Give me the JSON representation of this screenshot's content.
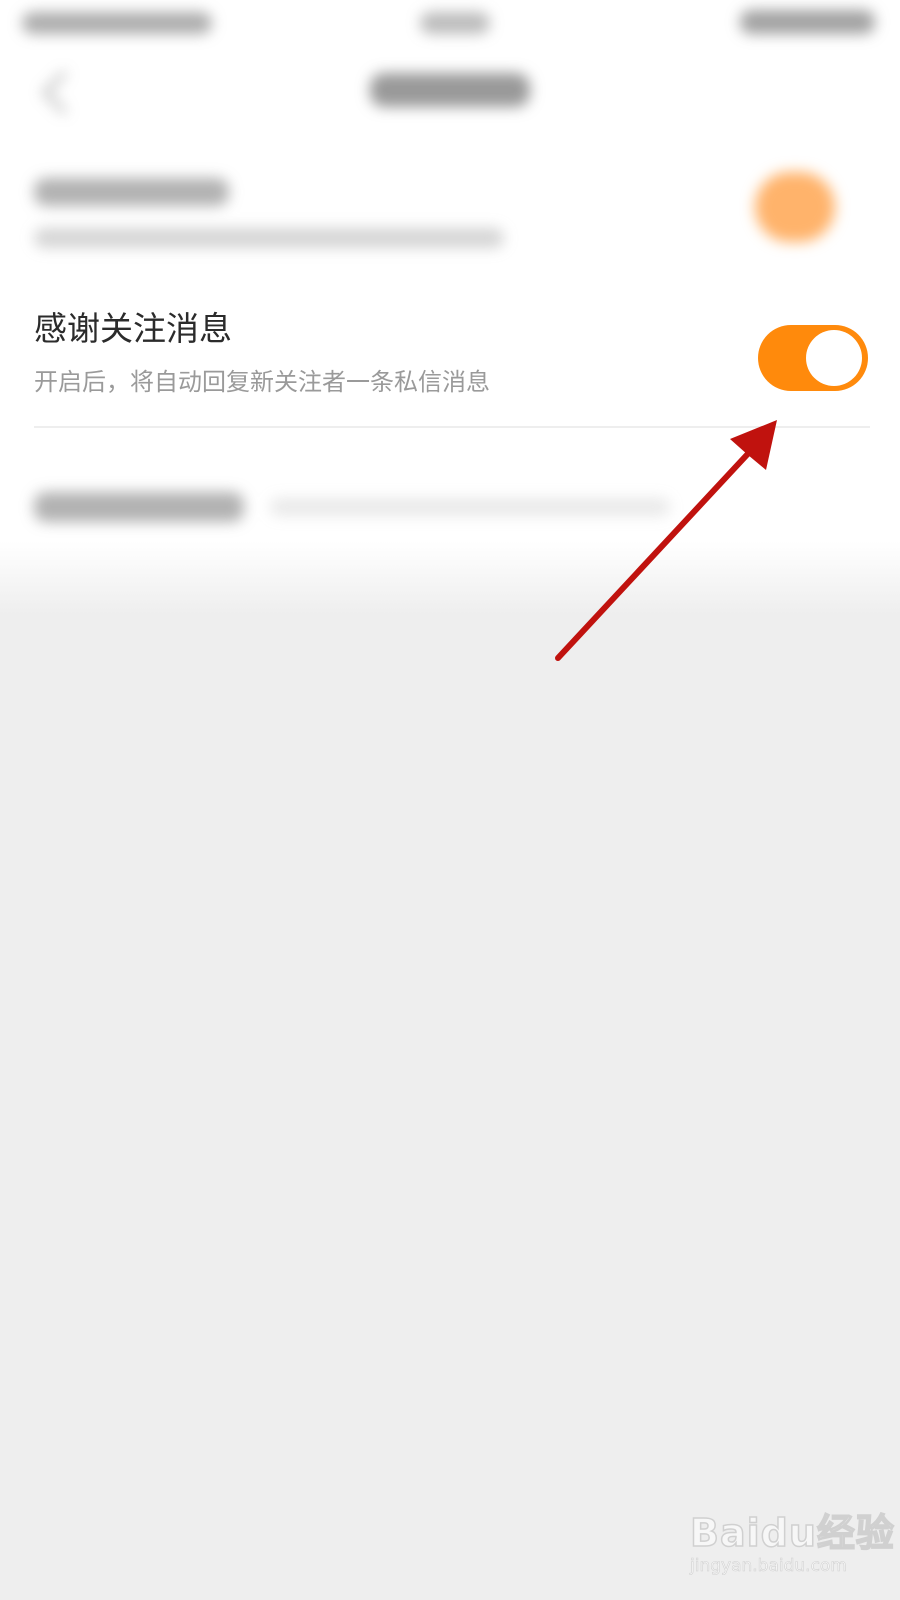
{
  "setting": {
    "title": "感谢关注消息",
    "description": "开启后，将自动回复新关注者一条私信消息",
    "enabled": true
  },
  "colors": {
    "toggle_on": "#ff8a0c",
    "annotation_arrow": "#c0120e",
    "background": "#eeeeee"
  },
  "watermark": {
    "logo": "Baidu经验",
    "url": "jingyan.baidu.com"
  },
  "icons": {
    "back": "back-arrow-icon",
    "annotation": "annotation-arrow-icon"
  }
}
